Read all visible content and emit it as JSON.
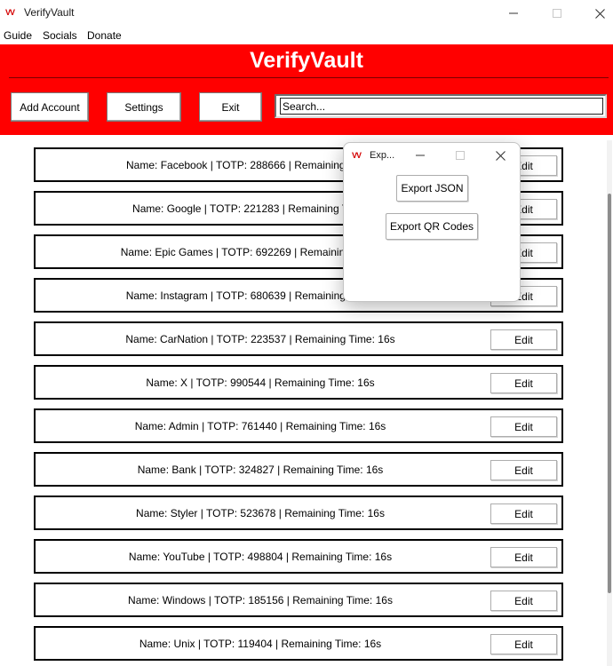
{
  "window": {
    "title": "VerifyVault",
    "logo_glyph": "VV",
    "minimize_glyph": "—",
    "maximize_glyph": "☐",
    "close_glyph": "✕"
  },
  "menu": [
    "Guide",
    "Socials",
    "Donate"
  ],
  "header": {
    "title": "VerifyVault",
    "background_color": "#ff0000",
    "add_account_label": "Add Account",
    "settings_label": "Settings",
    "exit_label": "Exit",
    "search_value": "Search..."
  },
  "accounts": [
    {
      "text": "Name: Facebook | TOTP: 288666 | Remaining Time: 16s",
      "edit_label": "Edit"
    },
    {
      "text": "Name: Google | TOTP: 221283 | Remaining Time: 16s",
      "edit_label": "Edit"
    },
    {
      "text": "Name: Epic Games | TOTP: 692269 | Remaining Time: 16s",
      "edit_label": "Edit"
    },
    {
      "text": "Name: Instagram | TOTP: 680639 | Remaining Time: 16s",
      "edit_label": "Edit"
    },
    {
      "text": "Name: CarNation | TOTP: 223537 | Remaining Time: 16s",
      "edit_label": "Edit"
    },
    {
      "text": "Name: X | TOTP: 990544 | Remaining Time: 16s",
      "edit_label": "Edit"
    },
    {
      "text": "Name: Admin | TOTP: 761440 | Remaining Time: 16s",
      "edit_label": "Edit"
    },
    {
      "text": "Name: Bank | TOTP: 324827 | Remaining Time: 16s",
      "edit_label": "Edit"
    },
    {
      "text": "Name: Styler | TOTP: 523678 | Remaining Time: 16s",
      "edit_label": "Edit"
    },
    {
      "text": "Name: YouTube | TOTP: 498804 | Remaining Time: 16s",
      "edit_label": "Edit"
    },
    {
      "text": "Name: Windows | TOTP: 185156 | Remaining Time: 16s",
      "edit_label": "Edit"
    },
    {
      "text": "Name: Unix | TOTP: 119404 | Remaining Time: 16s",
      "edit_label": "Edit"
    }
  ],
  "export_dialog": {
    "title": "Exp...",
    "export_json_label": "Export JSON",
    "export_qr_label": "Export QR Codes"
  }
}
